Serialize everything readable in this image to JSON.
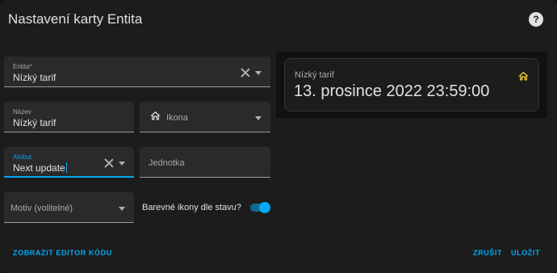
{
  "dialog": {
    "title": "Nastavení karty Entita"
  },
  "form": {
    "entity": {
      "label": "Entita*",
      "value": "Nízký tarif"
    },
    "name": {
      "label": "Název",
      "value": "Nízký tarif"
    },
    "icon": {
      "placeholder": "Ikona",
      "icon": "home-outline-icon"
    },
    "attribute": {
      "label": "Atribut",
      "value": "Next update"
    },
    "unit": {
      "placeholder": "Jednotka"
    },
    "theme": {
      "placeholder": "Motiv (volitelné)"
    },
    "state_color": {
      "label": "Barevné ikony dle stavu?",
      "on": true
    }
  },
  "preview": {
    "name": "Nízký tarif",
    "state": "13. prosince 2022 23:59:00",
    "icon": "home-outline-icon",
    "icon_color": "#fdd835"
  },
  "actions": {
    "show_code_editor": "ZOBRAZIT EDITOR KÓDU",
    "cancel": "ZRUŠIT",
    "save": "ULOŽIT"
  },
  "colors": {
    "accent": "#03a9f4",
    "surface": "#1c1c1c",
    "field_bg": "#2a2a2a"
  }
}
